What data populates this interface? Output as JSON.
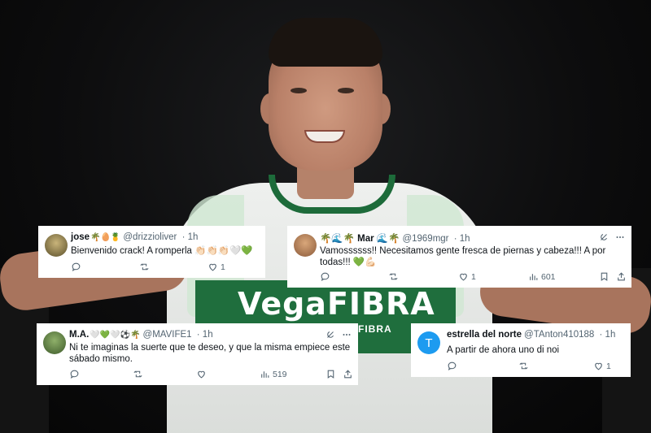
{
  "cards": [
    {
      "name": "jose",
      "name_emojis": "🌴🥚🍍",
      "handle": "@drizzioliver",
      "time": "· 1h",
      "text": "Bienvenido crack! A romperla 👏🏻👏🏻👏🏻🤍💚",
      "likes": "1"
    },
    {
      "name": "🌴🌊🌴 Mar 🌊🌴",
      "handle": "@1969mgr",
      "time": "· 1h",
      "text": "Vamossssss!! Necesitamos gente fresca de piernas y cabeza!!! A por todas!!! 💚💪🏻",
      "likes": "1",
      "views": "601"
    },
    {
      "name": "M.A.",
      "name_emojis": "🤍💚🤍⚽🌴",
      "handle": "@MAVIFE1",
      "time": "· 1h",
      "text": "Ni te imaginas la suerte que te deseo, y que la misma empiece este sábado mismo.",
      "views": "519"
    },
    {
      "name": "estrella del norte",
      "handle": "@TAnton410188",
      "time": "· 1h",
      "avatar_letter": "T",
      "text": "A partir de ahora uno di noi",
      "likes": "1"
    }
  ],
  "background": {
    "sponsor": "VegaFIBRA",
    "sponsor_sub": "FIBRA"
  },
  "colors": {
    "jersey_green": "#1f6e3d",
    "avatar_blue": "#1d9bf0",
    "muted_text": "#536471"
  }
}
